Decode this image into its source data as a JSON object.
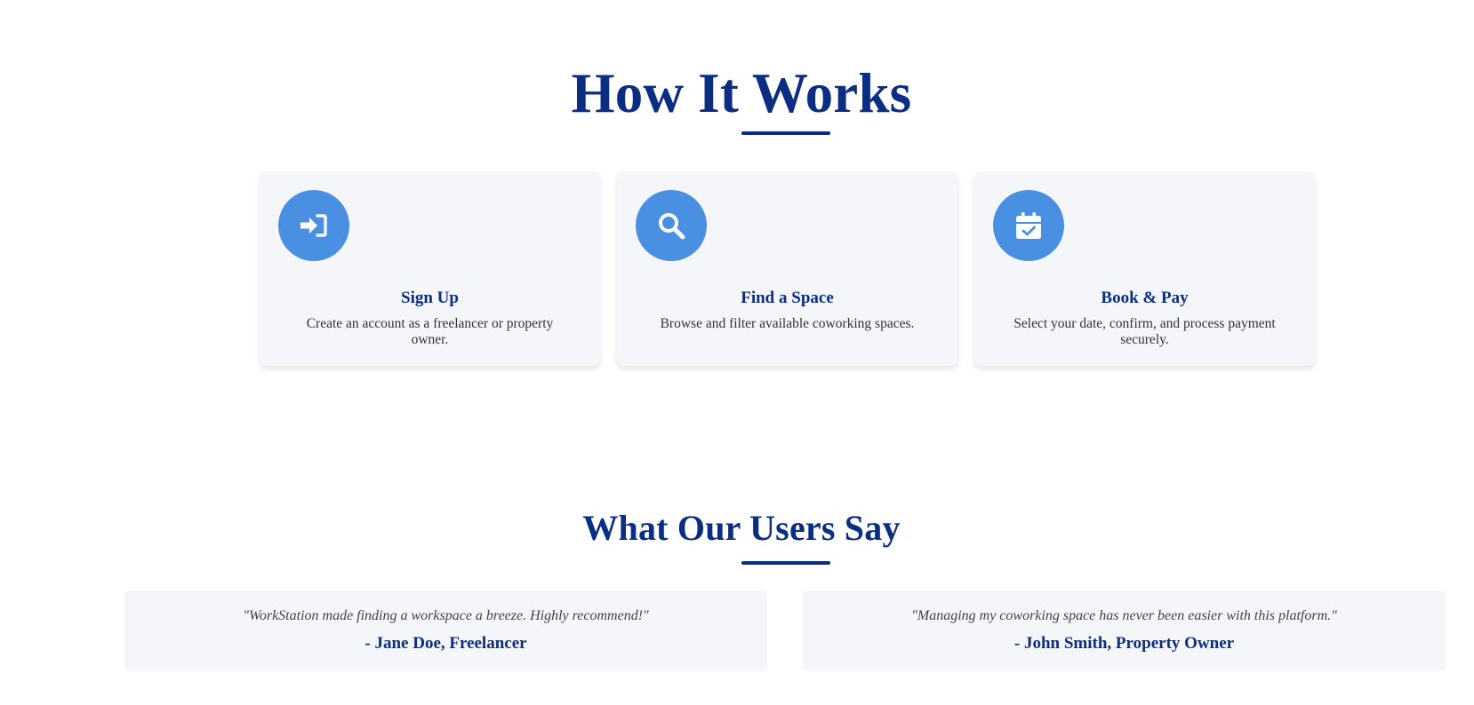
{
  "how_it_works": {
    "title": "How It Works",
    "steps": [
      {
        "icon": "sign-in-icon",
        "title": "Sign Up",
        "description": "Create an account as a freelancer or property owner."
      },
      {
        "icon": "search-icon",
        "title": "Find a Space",
        "description": "Browse and filter available coworking spaces."
      },
      {
        "icon": "calendar-check-icon",
        "title": "Book & Pay",
        "description": "Select your date, confirm, and process payment securely."
      }
    ]
  },
  "testimonials": {
    "title": "What Our Users Say",
    "items": [
      {
        "quote": "\"WorkStation made finding a workspace a breeze. Highly recommend!\"",
        "author": "- Jane Doe, Freelancer"
      },
      {
        "quote": "\"Managing my coworking space has never been easier with this platform.\"",
        "author": "- John Smith, Property Owner"
      }
    ]
  },
  "colors": {
    "heading": "#0b2e82",
    "icon_circle": "#4a90e2",
    "card_background": "#f5f6f9",
    "body_text": "#333333"
  }
}
